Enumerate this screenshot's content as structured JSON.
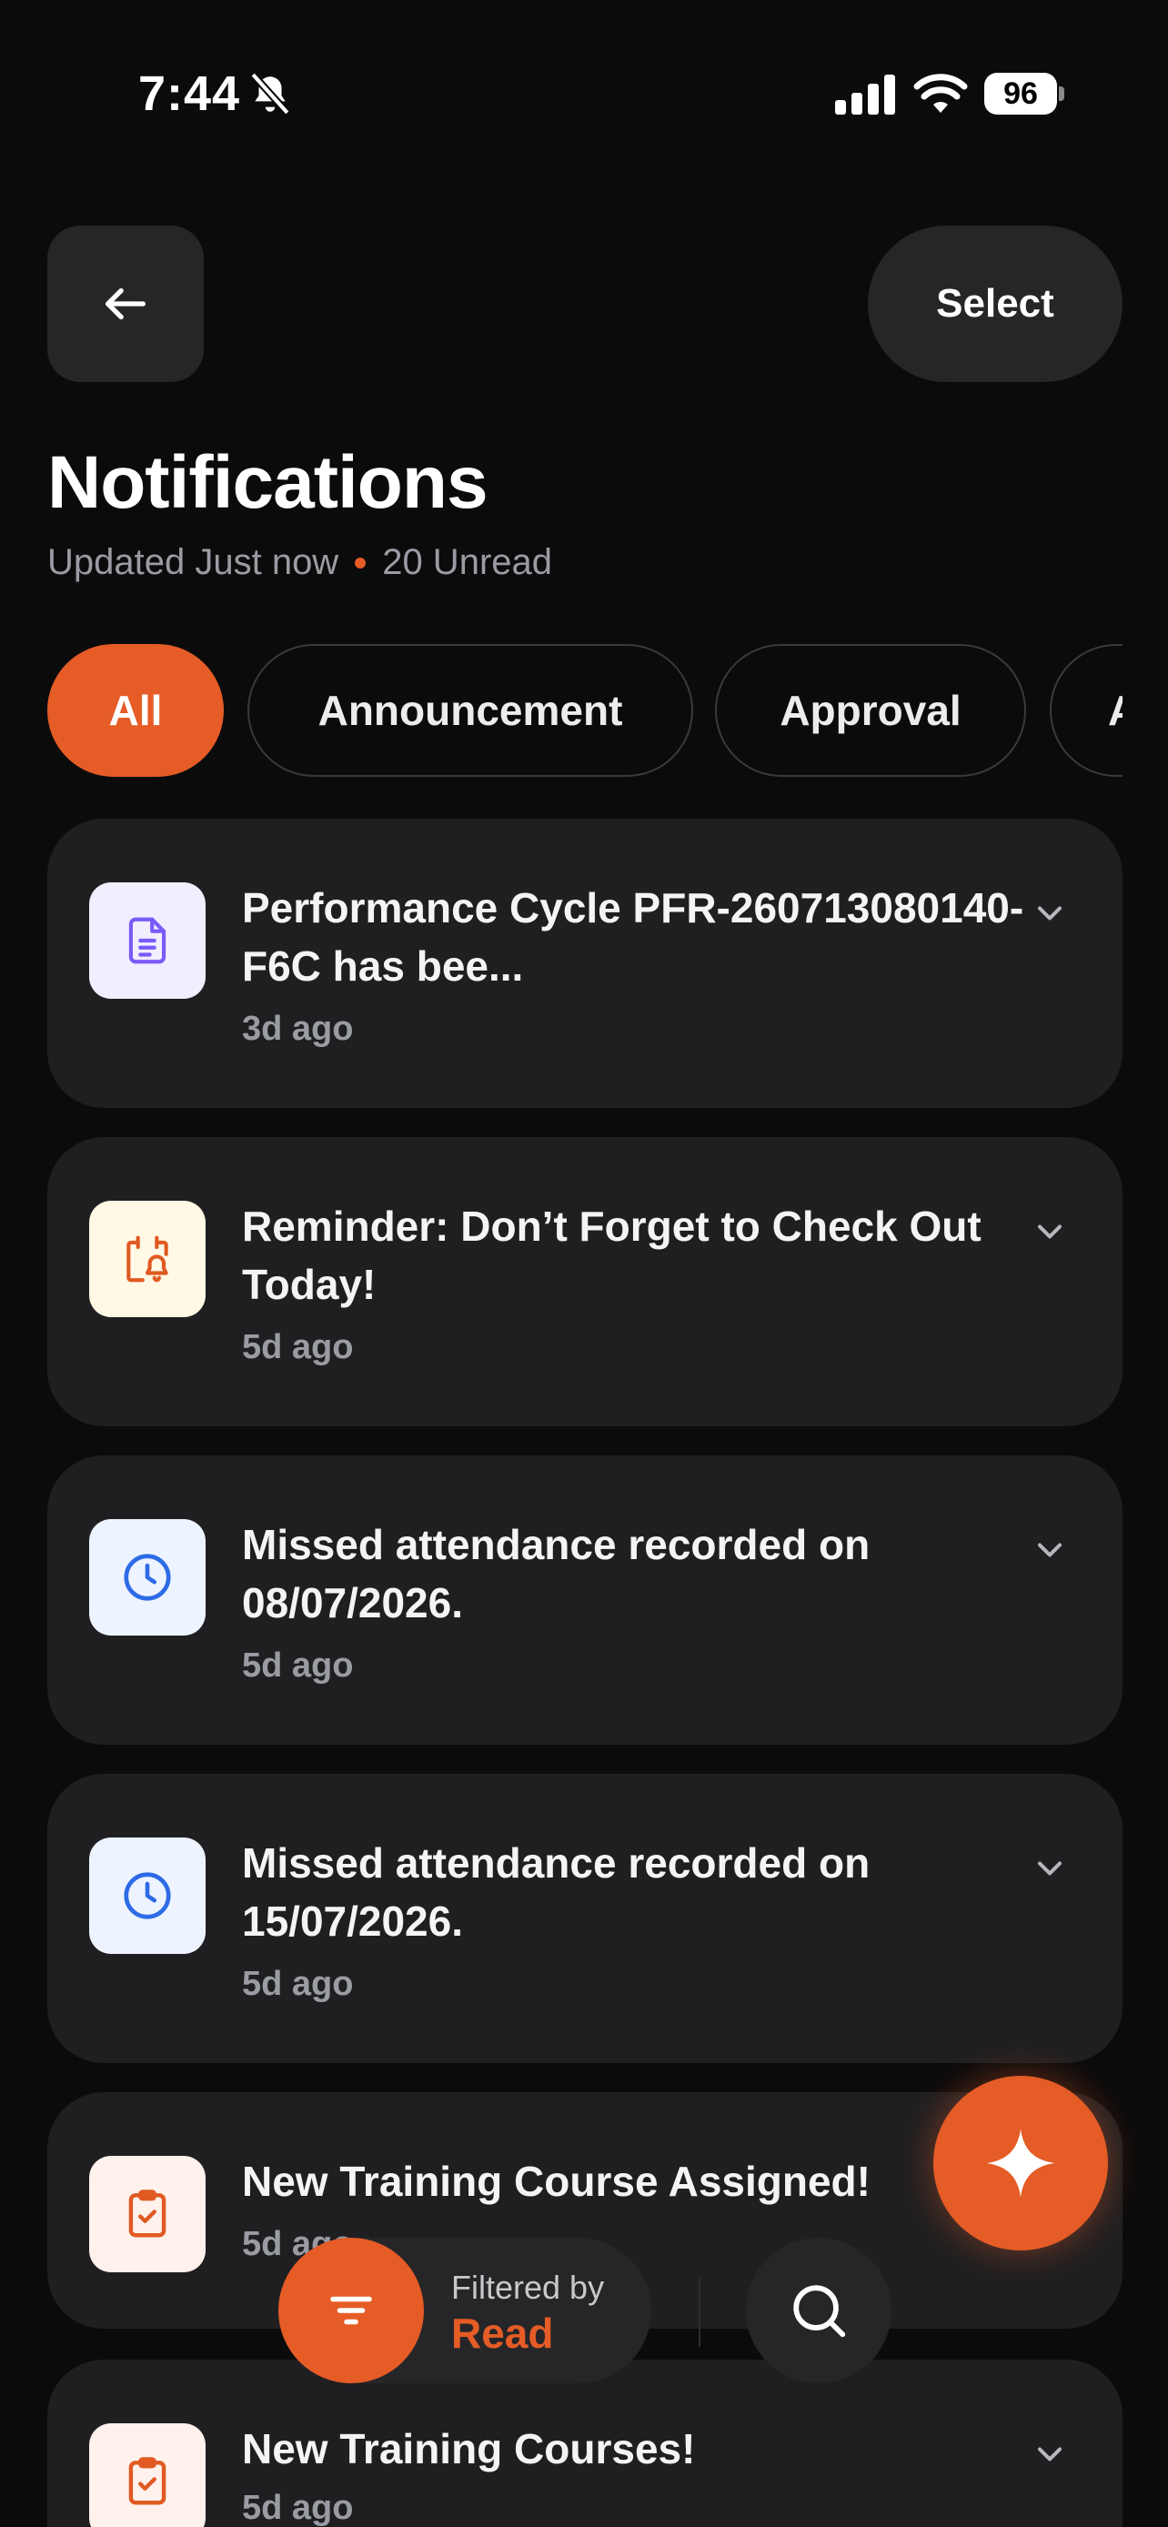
{
  "status_bar": {
    "time": "7:44",
    "battery": "96"
  },
  "header": {
    "select_label": "Select",
    "title": "Notifications",
    "updated_text": "Updated Just now",
    "unread_text": "20 Unread"
  },
  "filters": [
    {
      "label": "All",
      "active": true
    },
    {
      "label": "Announcement",
      "active": false
    },
    {
      "label": "Approval",
      "active": false
    },
    {
      "label": "A",
      "active": false
    }
  ],
  "notifications": [
    {
      "title": "Performance Cycle PFR-260713080140-F6C has bee...",
      "time": "3d ago",
      "icon": "document-icon",
      "icon_bg": "#f1eeff",
      "icon_color": "#7a5af8"
    },
    {
      "title": "Reminder: Don’t Forget to Check Out Today!",
      "time": "5d ago",
      "icon": "calendar-bell-icon",
      "icon_bg": "#fff9e6",
      "icon_color": "#e05a22"
    },
    {
      "title": "Missed attendance recorded on 08/07/2026.",
      "time": "5d ago",
      "icon": "clock-icon",
      "icon_bg": "#eef4ff",
      "icon_color": "#2e6be6"
    },
    {
      "title": "Missed attendance recorded on 15/07/2026.",
      "time": "5d ago",
      "icon": "clock-icon",
      "icon_bg": "#eef4ff",
      "icon_color": "#2e6be6"
    },
    {
      "title": "New Training Course Assigned!",
      "time": "5d ago",
      "icon": "clipboard-check-icon",
      "icon_bg": "#fff1ec",
      "icon_color": "#e05a22"
    },
    {
      "title": "New Training Courses!",
      "time": "5d ago",
      "icon": "clipboard-check-icon",
      "icon_bg": "#fff1ec",
      "icon_color": "#e05a22"
    }
  ],
  "filter_bar": {
    "label": "Filtered by",
    "value": "Read"
  },
  "colors": {
    "accent": "#e55c26",
    "background": "#0b0b0c",
    "card": "#1f1f21"
  }
}
